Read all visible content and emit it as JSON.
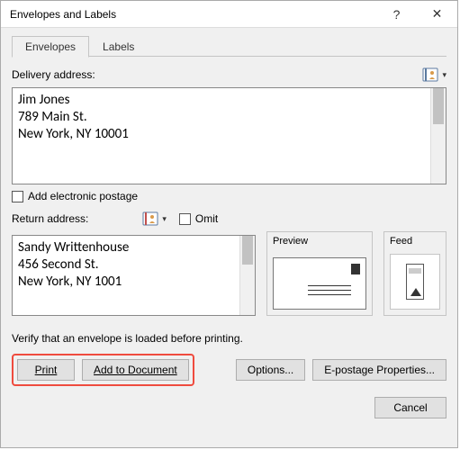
{
  "title": "Envelopes and Labels",
  "tabs": {
    "envelopes": "Envelopes",
    "labels": "Labels"
  },
  "delivery": {
    "label": "Delivery address:",
    "text": "Jim Jones\n789 Main St.\nNew York, NY 10001"
  },
  "electronic_postage": {
    "label": "Add electronic postage"
  },
  "return": {
    "label": "Return address:",
    "omit_label": "Omit",
    "text": "Sandy Writtenhouse\n456 Second St.\nNew York, NY 1001"
  },
  "preview": {
    "label": "Preview"
  },
  "feed": {
    "label": "Feed"
  },
  "verify_text": "Verify that an envelope is loaded before printing.",
  "buttons": {
    "print": "Print",
    "add_to_doc": "Add to Document",
    "options": "Options...",
    "epostage": "E-postage Properties...",
    "cancel": "Cancel"
  },
  "icons": {
    "help": "?",
    "close": "✕",
    "chev": "▾"
  }
}
